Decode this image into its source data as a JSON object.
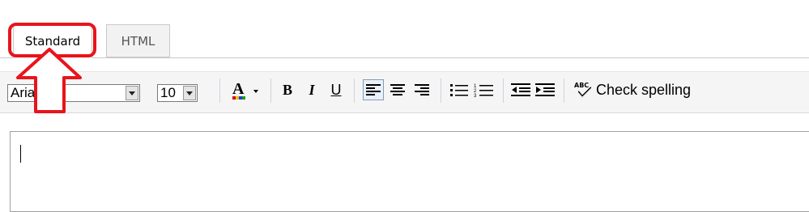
{
  "tabs": [
    {
      "label": "Standard",
      "active": true
    },
    {
      "label": "HTML",
      "active": false
    }
  ],
  "toolbar": {
    "font": "Arial",
    "size": "10",
    "bold": "B",
    "italic": "I",
    "underline": "U",
    "check_spelling_label": "Check spelling",
    "check_icon_text": "ABC"
  },
  "annotation": {
    "color": "#e8141c"
  },
  "editor": {
    "value": ""
  }
}
